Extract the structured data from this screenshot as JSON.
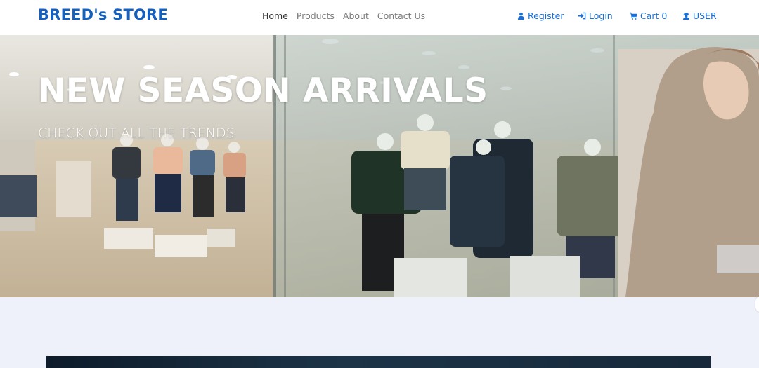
{
  "navbar": {
    "brand": "BREED's STORE",
    "links": [
      {
        "label": "Home",
        "active": true
      },
      {
        "label": "Products",
        "active": false
      },
      {
        "label": "About",
        "active": false
      },
      {
        "label": "Contact Us",
        "active": false
      }
    ],
    "register": {
      "label": "Register",
      "icon": "user-icon"
    },
    "login": {
      "label": "Login",
      "icon": "sign-in-icon"
    },
    "cart": {
      "label": "Cart 0",
      "icon": "shopping-cart-icon"
    },
    "user": {
      "label": "USER",
      "icon": "user-secret-icon"
    }
  },
  "hero": {
    "title": "NEW SEASON ARRIVALS",
    "subtitle": "CHECK OUT ALL THE TRENDS"
  },
  "colors": {
    "brand": "#1560bd",
    "link": "#1a6fd6",
    "page_background": "#eef0fa"
  }
}
